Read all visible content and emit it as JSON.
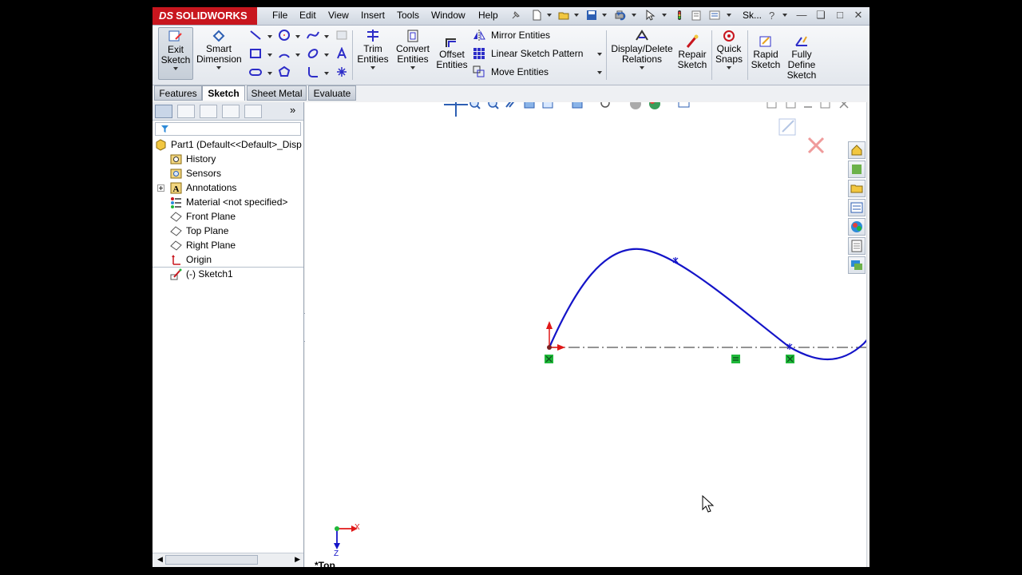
{
  "app": {
    "logo_prefix": "DS",
    "logo_name": "SOLIDWORKS",
    "doc_title_short": "Sk..."
  },
  "menus": [
    "File",
    "Edit",
    "View",
    "Insert",
    "Tools",
    "Window",
    "Help"
  ],
  "command_manager": {
    "exit_sketch": "Exit\nSketch",
    "smart_dimension": "Smart\nDimension",
    "trim_entities": "Trim\nEntities",
    "convert_entities": "Convert\nEntities",
    "offset_entities": "Offset\nEntities",
    "mirror_entities": "Mirror Entities",
    "linear_sketch_pattern": "Linear Sketch Pattern",
    "move_entities": "Move Entities",
    "display_delete_relations": "Display/Delete\nRelations",
    "repair_sketch": "Repair\nSketch",
    "quick_snaps": "Quick\nSnaps",
    "rapid_sketch": "Rapid\nSketch",
    "fully_define_sketch": "Fully\nDefine\nSketch"
  },
  "tabs": [
    {
      "label": "Features",
      "active": false
    },
    {
      "label": "Sketch",
      "active": true
    },
    {
      "label": "Sheet Metal",
      "active": false
    },
    {
      "label": "Evaluate",
      "active": false
    }
  ],
  "feature_tree": {
    "root": "Part1  (Default<<Default>_Disp",
    "items": [
      {
        "label": "History",
        "icon": "history-icon"
      },
      {
        "label": "Sensors",
        "icon": "sensors-icon"
      },
      {
        "label": "Annotations",
        "icon": "annotations-icon"
      },
      {
        "label": "Material <not specified>",
        "icon": "material-icon"
      },
      {
        "label": "Front Plane",
        "icon": "plane-icon"
      },
      {
        "label": "Top Plane",
        "icon": "plane-icon"
      },
      {
        "label": "Right Plane",
        "icon": "plane-icon"
      },
      {
        "label": "Origin",
        "icon": "origin-icon"
      },
      {
        "label": "(-) Sketch1",
        "icon": "sketch-icon"
      }
    ]
  },
  "graphics": {
    "view_name": "*Top",
    "triad_x": "X",
    "triad_z": "Z"
  },
  "colors": {
    "brand_red": "#c8161e",
    "sketch_blue": "#1414c8",
    "relation_green": "#1fb83a"
  }
}
